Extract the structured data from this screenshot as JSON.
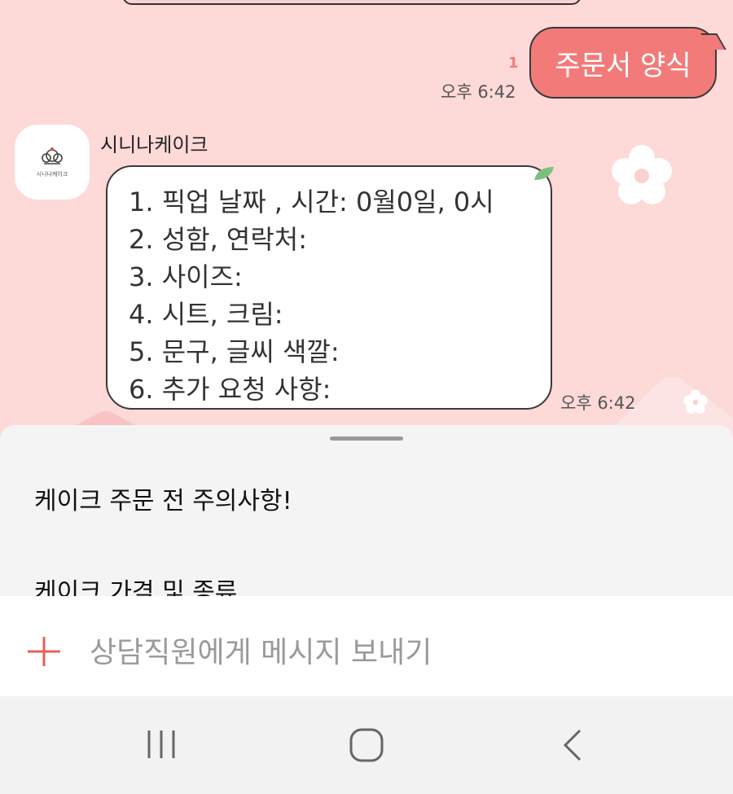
{
  "chat": {
    "my_message": "주문서 양식",
    "unread": "1",
    "my_time": "오후 6:42",
    "sender_name": "시니나케이크",
    "avatar_text": "시니나케이크",
    "bot_lines": [
      "1. 픽업 날짜 , 시간: 0월0일, 0시",
      "2. 성함, 연락처:",
      "3. 사이즈:",
      "4. 시트, 크림:",
      "5. 문구, 글씨 색깔:",
      "6. 추가 요청 사항:"
    ],
    "bot_time": "오후 6:42"
  },
  "sheet": {
    "items": [
      "케이크 주문 전 주의사항!",
      "케이크 가격 및 종류"
    ]
  },
  "input": {
    "placeholder": "상담직원에게 메시지 보내기"
  },
  "navbar": {
    "recent_icon": "recent-apps-icon",
    "home_icon": "home-icon",
    "back_icon": "back-icon"
  },
  "colors": {
    "chat_bg": "#fdd9d8",
    "my_bubble": "#f27b79",
    "plus": "#e8605e"
  }
}
